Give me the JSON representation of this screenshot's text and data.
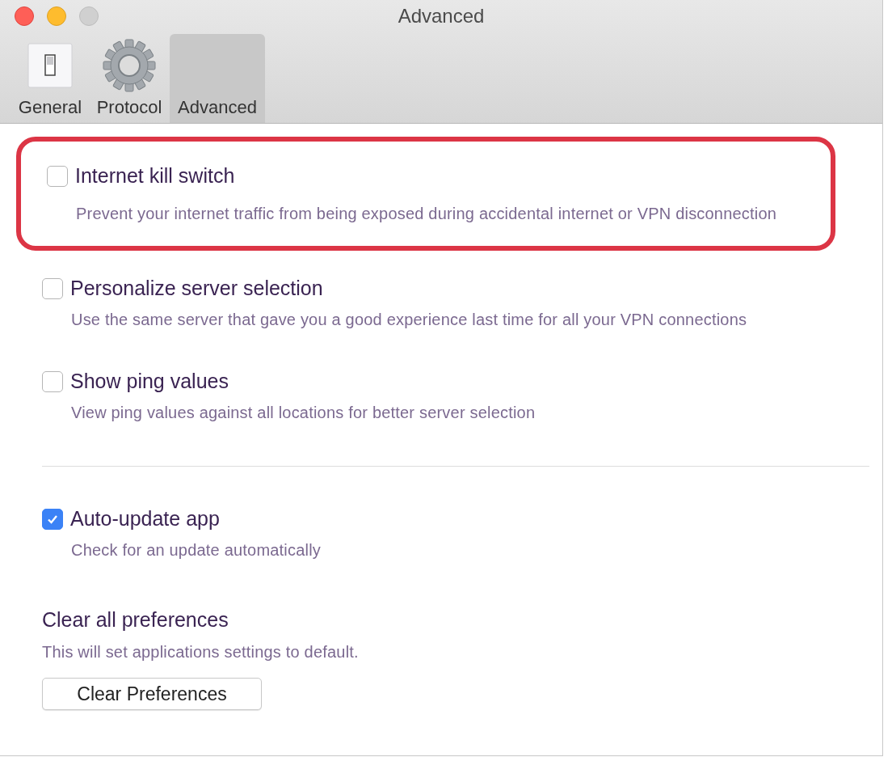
{
  "window": {
    "title": "Advanced"
  },
  "tabs": [
    {
      "label": "General",
      "selected": false
    },
    {
      "label": "Protocol",
      "selected": false
    },
    {
      "label": "Advanced",
      "selected": true
    }
  ],
  "options": [
    {
      "title": "Internet kill switch",
      "description": "Prevent your internet traffic from being exposed during accidental internet or VPN disconnection",
      "checked": false,
      "highlighted": true
    },
    {
      "title": "Personalize server selection",
      "description": "Use the same server that gave you a good experience last time for all your VPN connections",
      "checked": false,
      "highlighted": false
    },
    {
      "title": "Show ping values",
      "description": "View ping values against all locations for better server selection",
      "checked": false,
      "highlighted": false
    }
  ],
  "auto_update": {
    "title": "Auto-update app",
    "description": "Check for an update automatically",
    "checked": true
  },
  "clear": {
    "heading": "Clear all preferences",
    "description": "This will set applications settings to default.",
    "button": "Clear Preferences"
  }
}
